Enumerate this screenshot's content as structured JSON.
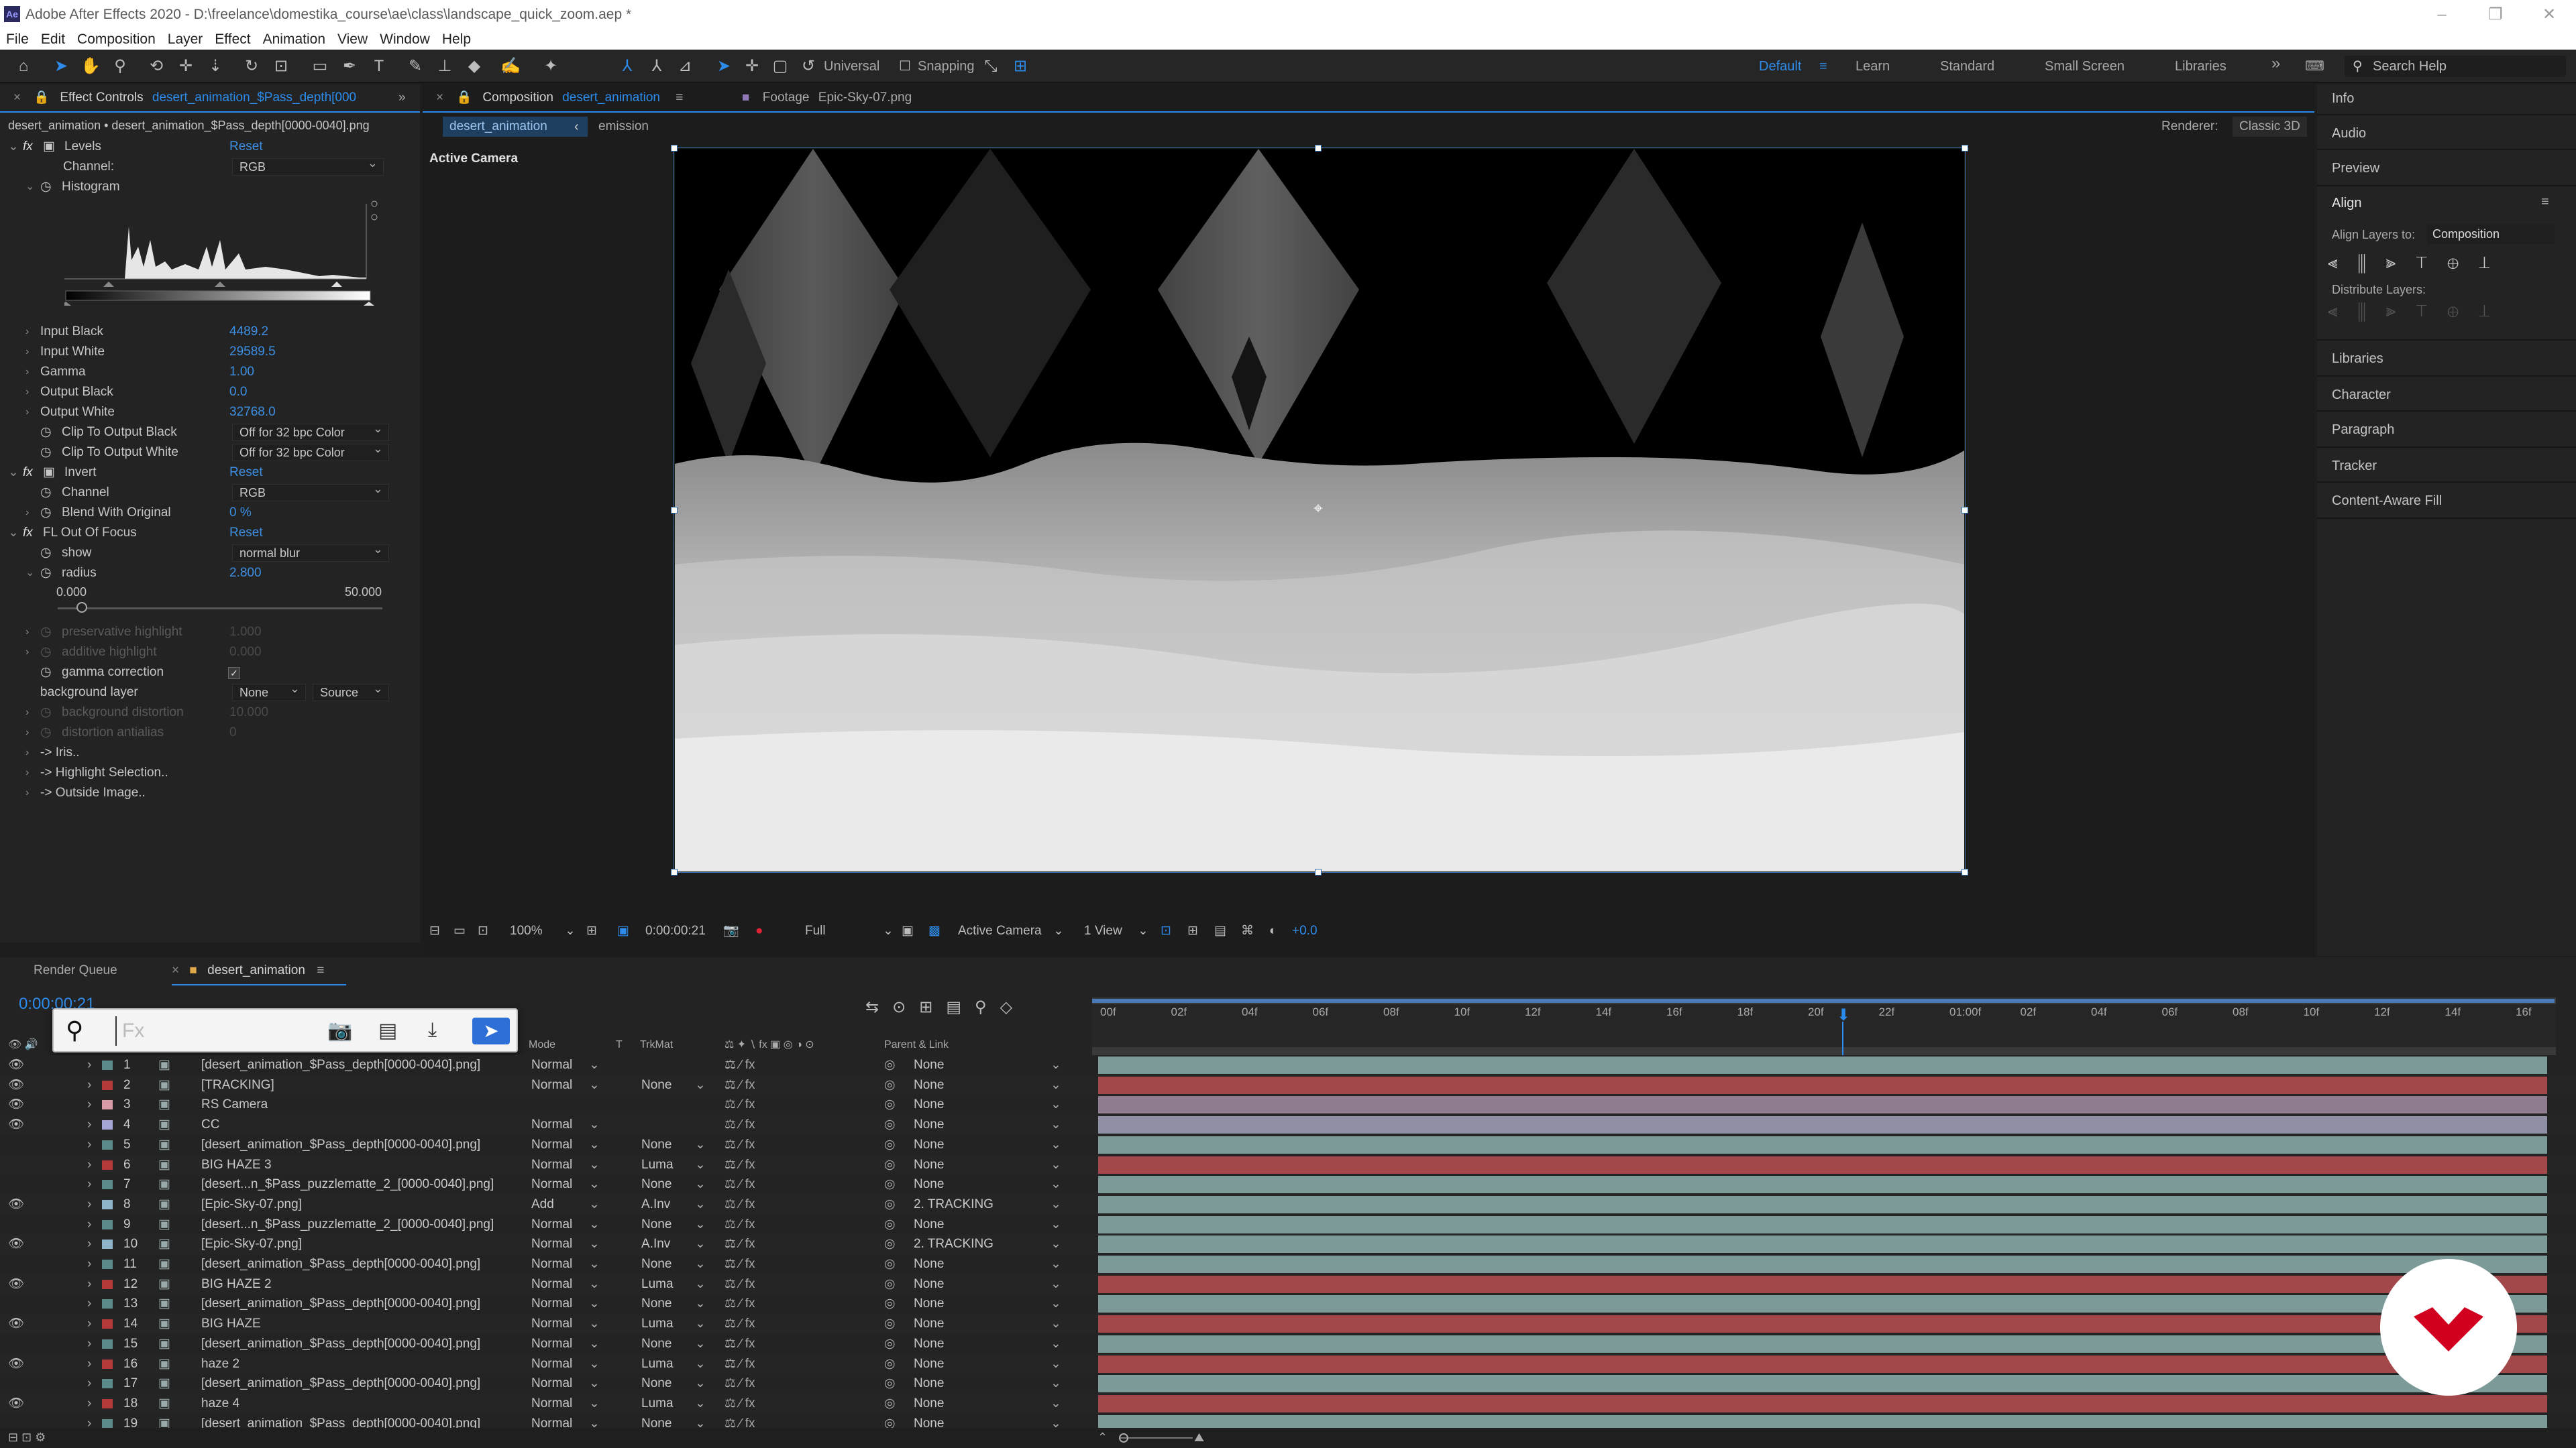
{
  "window": {
    "title": "Adobe After Effects 2020 - D:\\freelance\\domestika_course\\ae\\class\\landscape_quick_zoom.aep *",
    "app_icon": "Ae"
  },
  "menu": [
    "File",
    "Edit",
    "Composition",
    "Layer",
    "Effect",
    "Animation",
    "View",
    "Window",
    "Help"
  ],
  "toolbar": {
    "axis_mode": "Universal",
    "snapping": "Snapping",
    "workspaces": [
      "Default",
      "Learn",
      "Standard",
      "Small Screen",
      "Libraries"
    ],
    "search_placeholder": "Search Help"
  },
  "effect_controls": {
    "tab_label": "Effect Controls",
    "tab_layer": "desert_animation_$Pass_depth[000",
    "breadcrumb": "desert_animation • desert_animation_$Pass_depth[0000-0040].png",
    "levels": {
      "name": "Levels",
      "reset": "Reset",
      "channel_label": "Channel:",
      "channel_value": "RGB",
      "histogram_label": "Histogram",
      "params": [
        {
          "label": "Input Black",
          "value": "4489.2"
        },
        {
          "label": "Input White",
          "value": "29589.5"
        },
        {
          "label": "Gamma",
          "value": "1.00"
        },
        {
          "label": "Output Black",
          "value": "0.0"
        },
        {
          "label": "Output White",
          "value": "32768.0"
        }
      ],
      "clip_black_label": "Clip To Output Black",
      "clip_black_value": "Off for 32 bpc Color",
      "clip_white_label": "Clip To Output White",
      "clip_white_value": "Off for 32 bpc Color"
    },
    "invert": {
      "name": "Invert",
      "reset": "Reset",
      "channel_label": "Channel",
      "channel_value": "RGB",
      "blend_label": "Blend With Original",
      "blend_value": "0 %"
    },
    "focus": {
      "name": "FL Out Of Focus",
      "reset": "Reset",
      "show_label": "show",
      "show_value": "normal blur",
      "radius_label": "radius",
      "radius_value": "2.800",
      "radius_min": "0.000",
      "radius_max": "50.000",
      "pres_label": "preservative highlight",
      "pres_value": "1.000",
      "add_label": "additive highlight",
      "add_value": "0.000",
      "gamma_label": "gamma correction",
      "bg_label": "background layer",
      "bg_value": "None",
      "bg_source": "Source",
      "bgd_label": "background distortion",
      "bgd_value": "10.000",
      "da_label": "distortion antialias",
      "da_value": "0",
      "groups": [
        "-> Iris..",
        "-> Highlight Selection..",
        "-> Outside Image.."
      ]
    }
  },
  "comp_panel": {
    "tab_label": "Composition",
    "tab_name": "desert_animation",
    "footage_label": "Footage",
    "footage_name": "Epic-Sky-07.png",
    "sub_tabs": [
      "desert_animation",
      "emission"
    ],
    "renderer_label": "Renderer:",
    "renderer_value": "Classic 3D",
    "view_label": "Active Camera",
    "bottom": {
      "zoom": "100%",
      "timecode": "0:00:00:21",
      "resolution": "Full",
      "camera": "Active Camera",
      "views": "1 View",
      "exposure": "+0.0"
    }
  },
  "right_panel": {
    "items_top": [
      "Info",
      "Audio",
      "Preview"
    ],
    "align": {
      "title": "Align",
      "align_to_label": "Align Layers to:",
      "align_to_value": "Composition",
      "distribute_label": "Distribute Layers:"
    },
    "items_bottom": [
      "Libraries",
      "Character",
      "Paragraph",
      "Tracker",
      "Content-Aware Fill"
    ]
  },
  "timeline": {
    "tabs": [
      "Render Queue",
      "desert_animation"
    ],
    "timecode": "0:00:00:21",
    "search_placeholder": "Fx",
    "col_headers": {
      "mode": "Mode",
      "t": "T",
      "trkmat": "TrkMat",
      "parent": "Parent & Link"
    },
    "ruler": [
      "00f",
      "02f",
      "04f",
      "06f",
      "08f",
      "10f",
      "12f",
      "14f",
      "16f",
      "18f",
      "20f",
      "22f",
      "01:00f",
      "02f",
      "04f",
      "06f",
      "08f",
      "10f",
      "12f",
      "14f",
      "16f"
    ],
    "layers": [
      {
        "num": "1",
        "name": "[desert_animation_$Pass_depth[0000-0040].png]",
        "mode": "Normal",
        "trkmat": "",
        "parent": "None",
        "color": "#5b8a8a"
      },
      {
        "num": "2",
        "name": "[TRACKING]",
        "mode": "Normal",
        "trkmat": "None",
        "parent": "None",
        "color": "#b33a3a"
      },
      {
        "num": "3",
        "name": "RS Camera",
        "mode": "",
        "trkmat": "",
        "parent": "None",
        "color": "#d89aa6"
      },
      {
        "num": "4",
        "name": "CC",
        "mode": "Normal",
        "trkmat": "",
        "parent": "None",
        "color": "#a6a6d6"
      },
      {
        "num": "5",
        "name": "[desert_animation_$Pass_depth[0000-0040].png]",
        "mode": "Normal",
        "trkmat": "None",
        "parent": "None",
        "color": "#5b8a8a"
      },
      {
        "num": "6",
        "name": "BIG HAZE 3",
        "mode": "Normal",
        "trkmat": "Luma",
        "parent": "None",
        "color": "#b33a3a"
      },
      {
        "num": "7",
        "name": "[desert...n_$Pass_puzzlematte_2_[0000-0040].png]",
        "mode": "Normal",
        "trkmat": "None",
        "parent": "None",
        "color": "#5b8a8a"
      },
      {
        "num": "8",
        "name": "[Epic-Sky-07.png]",
        "mode": "Add",
        "trkmat": "A.Inv",
        "parent": "2. TRACKING",
        "color": "#8fb3c9"
      },
      {
        "num": "9",
        "name": "[desert...n_$Pass_puzzlematte_2_[0000-0040].png]",
        "mode": "Normal",
        "trkmat": "None",
        "parent": "None",
        "color": "#5b8a8a"
      },
      {
        "num": "10",
        "name": "[Epic-Sky-07.png]",
        "mode": "Normal",
        "trkmat": "A.Inv",
        "parent": "2. TRACKING",
        "color": "#8fb3c9"
      },
      {
        "num": "11",
        "name": "[desert_animation_$Pass_depth[0000-0040].png]",
        "mode": "Normal",
        "trkmat": "None",
        "parent": "None",
        "color": "#5b8a8a"
      },
      {
        "num": "12",
        "name": "BIG HAZE 2",
        "mode": "Normal",
        "trkmat": "Luma",
        "parent": "None",
        "color": "#b33a3a"
      },
      {
        "num": "13",
        "name": "[desert_animation_$Pass_depth[0000-0040].png]",
        "mode": "Normal",
        "trkmat": "None",
        "parent": "None",
        "color": "#5b8a8a"
      },
      {
        "num": "14",
        "name": "BIG HAZE",
        "mode": "Normal",
        "trkmat": "Luma",
        "parent": "None",
        "color": "#b33a3a"
      },
      {
        "num": "15",
        "name": "[desert_animation_$Pass_depth[0000-0040].png]",
        "mode": "Normal",
        "trkmat": "None",
        "parent": "None",
        "color": "#5b8a8a"
      },
      {
        "num": "16",
        "name": "haze 2",
        "mode": "Normal",
        "trkmat": "Luma",
        "parent": "None",
        "color": "#b33a3a"
      },
      {
        "num": "17",
        "name": "[desert_animation_$Pass_depth[0000-0040].png]",
        "mode": "Normal",
        "trkmat": "None",
        "parent": "None",
        "color": "#5b8a8a"
      },
      {
        "num": "18",
        "name": "haze 4",
        "mode": "Normal",
        "trkmat": "Luma",
        "parent": "None",
        "color": "#b33a3a"
      },
      {
        "num": "19",
        "name": "[desert_animation_$Pass_depth[0000-0040].png]",
        "mode": "Normal",
        "trkmat": "None",
        "parent": "None",
        "color": "#5b8a8a"
      }
    ]
  },
  "colors": {
    "accent": "#2d8ceb",
    "panel": "#232323",
    "bar_teal": "#7b9a98",
    "bar_red": "#a2474a",
    "bar_mauve": "#8f7c8e",
    "logo_red": "#d1001f"
  }
}
